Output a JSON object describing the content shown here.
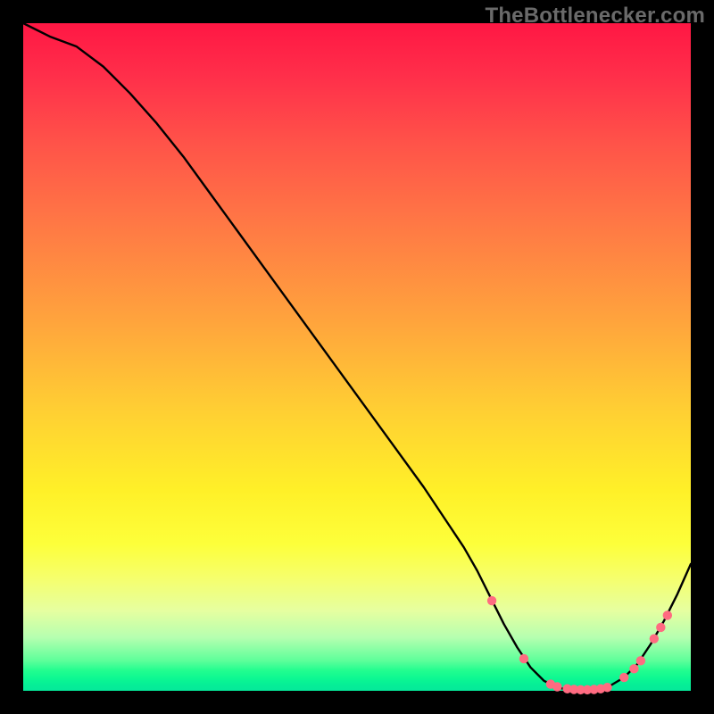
{
  "watermark": "TheBottlenecker.com",
  "chart_data": {
    "type": "line",
    "title": "",
    "xlabel": "",
    "ylabel": "",
    "xlim": [
      0,
      100
    ],
    "ylim": [
      0,
      100
    ],
    "series": [
      {
        "name": "bottleneck-curve",
        "x": [
          0,
          4,
          8,
          12,
          16,
          20,
          24,
          28,
          32,
          36,
          40,
          44,
          48,
          52,
          56,
          60,
          64,
          66,
          68,
          70,
          72,
          74,
          76,
          78,
          80,
          82,
          84,
          86,
          88,
          90,
          92,
          94,
          96,
          98,
          100
        ],
        "y": [
          100,
          98,
          96.5,
          93.5,
          89.5,
          85,
          80,
          74.5,
          69,
          63.5,
          58,
          52.5,
          47,
          41.5,
          36,
          30.5,
          24.5,
          21.5,
          18,
          14,
          10,
          6.5,
          3.5,
          1.5,
          0.5,
          0.1,
          0.1,
          0.3,
          0.8,
          2.0,
          4.0,
          7.0,
          10.5,
          14.5,
          19.0
        ]
      }
    ],
    "markers": {
      "name": "highlight-points",
      "color": "#ff6b81",
      "points": [
        {
          "x": 70.2,
          "y": 13.5
        },
        {
          "x": 75.0,
          "y": 4.8
        },
        {
          "x": 79.0,
          "y": 1.0
        },
        {
          "x": 80.0,
          "y": 0.6
        },
        {
          "x": 81.5,
          "y": 0.3
        },
        {
          "x": 82.5,
          "y": 0.2
        },
        {
          "x": 83.5,
          "y": 0.15
        },
        {
          "x": 84.5,
          "y": 0.15
        },
        {
          "x": 85.5,
          "y": 0.2
        },
        {
          "x": 86.5,
          "y": 0.3
        },
        {
          "x": 87.5,
          "y": 0.5
        },
        {
          "x": 90.0,
          "y": 2.0
        },
        {
          "x": 91.5,
          "y": 3.3
        },
        {
          "x": 92.5,
          "y": 4.5
        },
        {
          "x": 94.5,
          "y": 7.8
        },
        {
          "x": 95.5,
          "y": 9.5
        },
        {
          "x": 96.5,
          "y": 11.3
        }
      ]
    },
    "background": {
      "type": "vertical-gradient",
      "stops": [
        {
          "pos": 0.0,
          "color": "#ff1744"
        },
        {
          "pos": 0.3,
          "color": "#ff7845"
        },
        {
          "pos": 0.58,
          "color": "#ffcf33"
        },
        {
          "pos": 0.78,
          "color": "#fdff3a"
        },
        {
          "pos": 0.95,
          "color": "#5dff9a"
        },
        {
          "pos": 1.0,
          "color": "#05e99a"
        }
      ]
    }
  }
}
